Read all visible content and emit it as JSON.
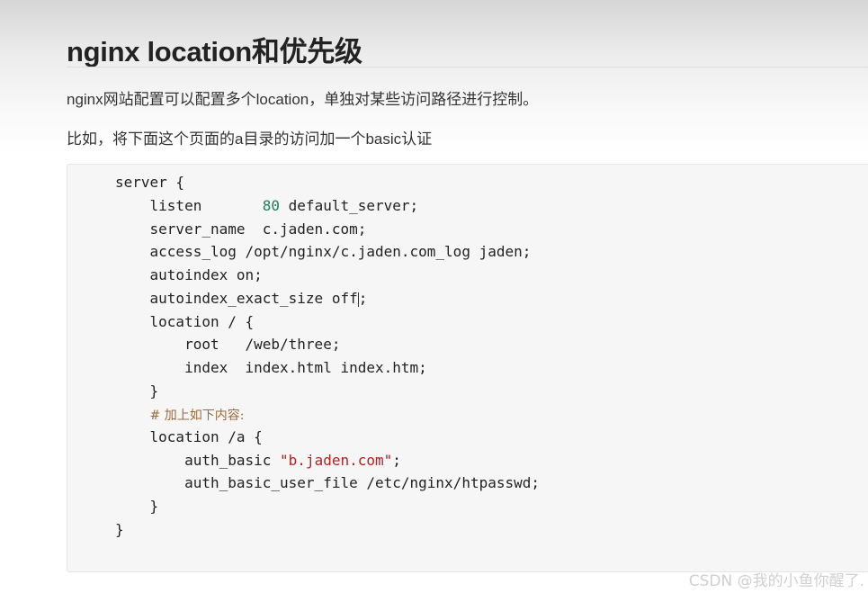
{
  "article": {
    "title": "nginx location和优先级",
    "paragraph1": "nginx网站配置可以配置多个location，单独对某些访问路径进行控制。",
    "paragraph2": "比如，将下面这个页面的a目录的访问加一个basic认证"
  },
  "code": {
    "l1": "server {",
    "l2_a": "    listen       ",
    "l2_num": "80",
    "l2_b": " default_server;",
    "l3": "    server_name  c.jaden.com;",
    "l4": "    access_log /opt/nginx/c.jaden.com_log jaden;",
    "l5": "    autoindex on;",
    "l6_a": "    autoindex_exact_size off",
    "l6_b": ";",
    "l7": "    location / {",
    "l8": "        root   /web/three;",
    "l9": "        index  index.html index.htm;",
    "l10": "    }",
    "l11_indent": "    ",
    "l11_comment": "# 加上如下内容:",
    "l12": "    location /a {",
    "l13_a": "        auth_basic ",
    "l13_str": "\"b.jaden.com\"",
    "l13_b": ";",
    "l14": "        auth_basic_user_file /etc/nginx/htpasswd;",
    "l15": "    }",
    "l16": "}"
  },
  "watermark": "CSDN @我的小鱼你醒了.",
  "colors": {
    "number": "#1a7f5a",
    "string": "#b22222",
    "comment": "#9a6b3b"
  }
}
